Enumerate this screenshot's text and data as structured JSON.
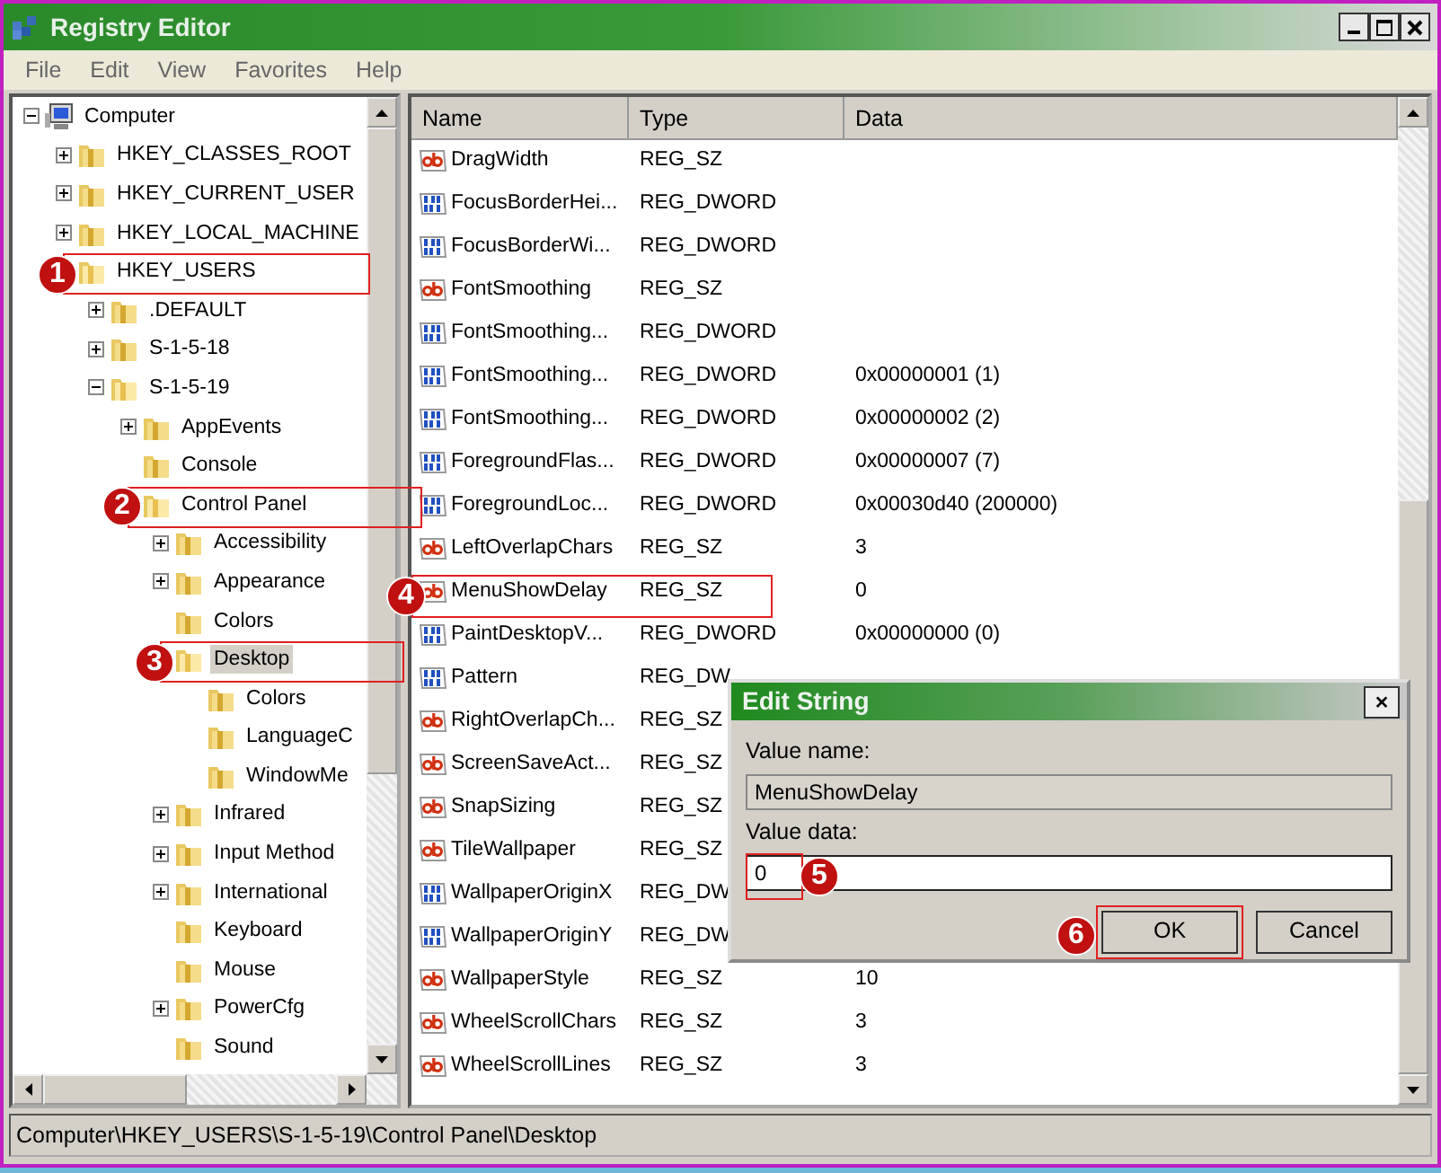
{
  "window": {
    "title": "Registry Editor"
  },
  "menu": [
    "File",
    "Edit",
    "View",
    "Favorites",
    "Help"
  ],
  "tree": [
    {
      "label": "Computer",
      "kind": "computer",
      "expanded": true,
      "expandable": true,
      "selected": false,
      "children": [
        {
          "label": "HKEY_CLASSES_ROOT",
          "kind": "folder",
          "expanded": false,
          "expandable": true,
          "selected": false
        },
        {
          "label": "HKEY_CURRENT_USER",
          "kind": "folder",
          "expanded": false,
          "expandable": true,
          "selected": false
        },
        {
          "label": "HKEY_LOCAL_MACHINE",
          "kind": "folder",
          "expanded": false,
          "expandable": true,
          "selected": false
        },
        {
          "label": "HKEY_USERS",
          "kind": "folder",
          "expanded": true,
          "expandable": true,
          "selected": false,
          "callout": "1",
          "children": [
            {
              "label": ".DEFAULT",
              "kind": "folder",
              "expanded": false,
              "expandable": true,
              "selected": false
            },
            {
              "label": "S-1-5-18",
              "kind": "folder",
              "expanded": false,
              "expandable": true,
              "selected": false
            },
            {
              "label": "S-1-5-19",
              "kind": "folder",
              "expanded": true,
              "expandable": true,
              "selected": false,
              "children": [
                {
                  "label": "AppEvents",
                  "kind": "folder",
                  "expanded": false,
                  "expandable": true,
                  "selected": false
                },
                {
                  "label": "Console",
                  "kind": "folder",
                  "expanded": false,
                  "expandable": false,
                  "selected": false
                },
                {
                  "label": "Control Panel",
                  "kind": "folder",
                  "expanded": true,
                  "expandable": true,
                  "selected": false,
                  "callout": "2",
                  "children": [
                    {
                      "label": "Accessibility",
                      "kind": "folder",
                      "expanded": false,
                      "expandable": true,
                      "selected": false
                    },
                    {
                      "label": "Appearance",
                      "kind": "folder",
                      "expanded": false,
                      "expandable": true,
                      "selected": false
                    },
                    {
                      "label": "Colors",
                      "kind": "folder",
                      "expanded": false,
                      "expandable": false,
                      "selected": false
                    },
                    {
                      "label": "Desktop",
                      "kind": "folder",
                      "expanded": true,
                      "expandable": true,
                      "selected": true,
                      "callout": "3",
                      "children": [
                        {
                          "label": "Colors",
                          "kind": "folder",
                          "expanded": false,
                          "expandable": false,
                          "selected": false
                        },
                        {
                          "label": "LanguageC",
                          "kind": "folder",
                          "expanded": false,
                          "expandable": false,
                          "selected": false
                        },
                        {
                          "label": "WindowMe",
                          "kind": "folder",
                          "expanded": false,
                          "expandable": false,
                          "selected": false
                        }
                      ]
                    },
                    {
                      "label": "Infrared",
                      "kind": "folder",
                      "expanded": false,
                      "expandable": true,
                      "selected": false
                    },
                    {
                      "label": "Input Method",
                      "kind": "folder",
                      "expanded": false,
                      "expandable": true,
                      "selected": false
                    },
                    {
                      "label": "International",
                      "kind": "folder",
                      "expanded": false,
                      "expandable": true,
                      "selected": false
                    },
                    {
                      "label": "Keyboard",
                      "kind": "folder",
                      "expanded": false,
                      "expandable": false,
                      "selected": false
                    },
                    {
                      "label": "Mouse",
                      "kind": "folder",
                      "expanded": false,
                      "expandable": false,
                      "selected": false
                    },
                    {
                      "label": "PowerCfg",
                      "kind": "folder",
                      "expanded": false,
                      "expandable": true,
                      "selected": false
                    },
                    {
                      "label": "Sound",
                      "kind": "folder",
                      "expanded": false,
                      "expandable": false,
                      "selected": false
                    }
                  ]
                }
              ]
            }
          ]
        }
      ]
    }
  ],
  "table": {
    "columns": [
      "Name",
      "Type",
      "Data"
    ],
    "rows": [
      {
        "kind": "string",
        "name": "DragWidth",
        "type": "REG_SZ"
      },
      {
        "kind": "binary",
        "name": "FocusBorderHei...",
        "type": "REG_DWORD"
      },
      {
        "kind": "binary",
        "name": "FocusBorderWi...",
        "type": "REG_DWORD"
      },
      {
        "kind": "string",
        "name": "FontSmoothing",
        "type": "REG_SZ"
      },
      {
        "kind": "binary",
        "name": "FontSmoothing...",
        "type": "REG_DWORD"
      },
      {
        "kind": "binary",
        "name": "FontSmoothing...",
        "type": "REG_DWORD",
        "data": "0x00000001 (1)"
      },
      {
        "kind": "binary",
        "name": "FontSmoothing...",
        "type": "REG_DWORD",
        "data": "0x00000002 (2)"
      },
      {
        "kind": "binary",
        "name": "ForegroundFlas...",
        "type": "REG_DWORD",
        "data": "0x00000007 (7)"
      },
      {
        "kind": "binary",
        "name": "ForegroundLoc...",
        "type": "REG_DWORD",
        "data": "0x00030d40 (200000)"
      },
      {
        "kind": "string",
        "name": "LeftOverlapChars",
        "type": "REG_SZ",
        "data": "3"
      },
      {
        "kind": "string",
        "name": "MenuShowDelay",
        "type": "REG_SZ",
        "data": "0",
        "callout": "4"
      },
      {
        "kind": "binary",
        "name": "PaintDesktopV...",
        "type": "REG_DWORD",
        "data": "0x00000000 (0)"
      },
      {
        "kind": "binary",
        "name": "Pattern",
        "type": "REG_DW"
      },
      {
        "kind": "string",
        "name": "RightOverlapCh...",
        "type": "REG_SZ"
      },
      {
        "kind": "string",
        "name": "ScreenSaveAct...",
        "type": "REG_SZ"
      },
      {
        "kind": "string",
        "name": "SnapSizing",
        "type": "REG_SZ"
      },
      {
        "kind": "string",
        "name": "TileWallpaper",
        "type": "REG_SZ"
      },
      {
        "kind": "binary",
        "name": "WallpaperOriginX",
        "type": "REG_DW"
      },
      {
        "kind": "binary",
        "name": "WallpaperOriginY",
        "type": "REG_DW"
      },
      {
        "kind": "string",
        "name": "WallpaperStyle",
        "type": "REG_SZ",
        "data": "10"
      },
      {
        "kind": "string",
        "name": "WheelScrollChars",
        "type": "REG_SZ",
        "data": "3"
      },
      {
        "kind": "string",
        "name": "WheelScrollLines",
        "type": "REG_SZ",
        "data": "3"
      }
    ]
  },
  "dialog": {
    "title": "Edit String",
    "close": "×",
    "value_name_label": "Value name:",
    "value_name": "MenuShowDelay",
    "value_data_label": "Value data:",
    "value_data": "0",
    "value_data_callout": "5",
    "buttons": [
      {
        "label": "OK",
        "callout": "6"
      },
      {
        "label": "Cancel"
      }
    ]
  },
  "status_bar": "Computer\\HKEY_USERS\\S-1-5-19\\Control Panel\\Desktop"
}
